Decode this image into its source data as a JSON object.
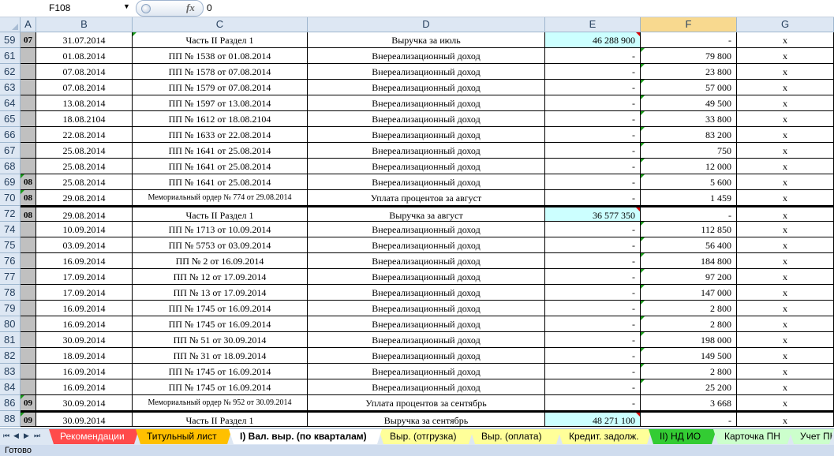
{
  "formula_bar": {
    "cell_ref": "F108",
    "fx_label": "fx",
    "value": "0"
  },
  "columns": [
    "A",
    "B",
    "C",
    "D",
    "E",
    "F",
    "G"
  ],
  "active_column": "F",
  "rows": [
    {
      "num": "59",
      "a": "07",
      "b": "31.07.2014",
      "c": "Часть II Раздел 1",
      "d": "Выручка за июль",
      "e": "46 288 900",
      "f": "-",
      "g": "x",
      "hl": true,
      "cg": true,
      "er": true
    },
    {
      "num": "61",
      "a": "",
      "b": "01.08.2014",
      "c": "ПП № 1538 от 01.08.2014",
      "d": "Внереализационный доход",
      "e": "-",
      "f": "79 800",
      "g": "x",
      "fg": true
    },
    {
      "num": "62",
      "a": "",
      "b": "07.08.2014",
      "c": "ПП № 1578 от 07.08.2014",
      "d": "Внереализационный доход",
      "e": "-",
      "f": "23 800",
      "g": "x",
      "fg": true
    },
    {
      "num": "63",
      "a": "",
      "b": "07.08.2014",
      "c": "ПП № 1579 от 07.08.2014",
      "d": "Внереализационный доход",
      "e": "-",
      "f": "57 000",
      "g": "x",
      "fg": true
    },
    {
      "num": "64",
      "a": "",
      "b": "13.08.2014",
      "c": "ПП № 1597 от 13.08.2014",
      "d": "Внереализационный доход",
      "e": "-",
      "f": "49 500",
      "g": "x",
      "fg": true
    },
    {
      "num": "65",
      "a": "",
      "b": "18.08.2104",
      "c": "ПП № 1612 от 18.08.2104",
      "d": "Внереализационный доход",
      "e": "-",
      "f": "33 800",
      "g": "x",
      "fg": true
    },
    {
      "num": "66",
      "a": "",
      "b": "22.08.2014",
      "c": "ПП № 1633 от 22.08.2014",
      "d": "Внереализационный доход",
      "e": "-",
      "f": "83 200",
      "g": "x",
      "fg": true
    },
    {
      "num": "67",
      "a": "",
      "b": "25.08.2014",
      "c": "ПП № 1641 от 25.08.2014",
      "d": "Внереализационный доход",
      "e": "-",
      "f": "750",
      "g": "x",
      "fg": true
    },
    {
      "num": "68",
      "a": "",
      "b": "25.08.2014",
      "c": "ПП № 1641 от 25.08.2014",
      "d": "Внереализационный доход",
      "e": "-",
      "f": "12 000",
      "g": "x",
      "fg": true
    },
    {
      "num": "69",
      "a": "08",
      "b": "25.08.2014",
      "c": "ПП № 1641 от 25.08.2014",
      "d": "Внереализационный доход",
      "e": "-",
      "f": "5 600",
      "g": "x",
      "fg": true,
      "ag": true
    },
    {
      "num": "70",
      "a": "08",
      "b": "29.08.2014",
      "c": "Мемориальный ордер № 774 от 29.08.2014",
      "d": "Уплата процентов за август",
      "e": "-",
      "f": "1 459",
      "g": "x",
      "small": true,
      "ag": true
    },
    {
      "num": "72",
      "a": "08",
      "b": "29.08.2014",
      "c": "Часть II Раздел 1",
      "d": "Выручка за август",
      "e": "36 577 350",
      "f": "-",
      "g": "x",
      "hl": true,
      "er": true,
      "thick": true
    },
    {
      "num": "74",
      "a": "",
      "b": "10.09.2014",
      "c": "ПП № 1713 от 10.09.2014",
      "d": "Внереализационный доход",
      "e": "-",
      "f": "112 850",
      "g": "x",
      "fg": true
    },
    {
      "num": "75",
      "a": "",
      "b": "03.09.2014",
      "c": "ПП № 5753 от 03.09.2014",
      "d": "Внереализационный доход",
      "e": "-",
      "f": "56 400",
      "g": "x",
      "fg": true
    },
    {
      "num": "76",
      "a": "",
      "b": "16.09.2014",
      "c": "ПП № 2 от 16.09.2014",
      "d": "Внереализационный доход",
      "e": "-",
      "f": "184 800",
      "g": "x",
      "fg": true
    },
    {
      "num": "77",
      "a": "",
      "b": "17.09.2014",
      "c": "ПП № 12 от 17.09.2014",
      "d": "Внереализационный доход",
      "e": "-",
      "f": "97 200",
      "g": "x",
      "fg": true
    },
    {
      "num": "78",
      "a": "",
      "b": "17.09.2014",
      "c": "ПП № 13 от 17.09.2014",
      "d": "Внереализационный доход",
      "e": "-",
      "f": "147 000",
      "g": "x",
      "fg": true
    },
    {
      "num": "79",
      "a": "",
      "b": "16.09.2014",
      "c": "ПП № 1745 от 16.09.2014",
      "d": "Внереализационный доход",
      "e": "-",
      "f": "2 800",
      "g": "x",
      "fg": true
    },
    {
      "num": "80",
      "a": "",
      "b": "16.09.2014",
      "c": "ПП № 1745 от 16.09.2014",
      "d": "Внереализационный доход",
      "e": "-",
      "f": "2 800",
      "g": "x",
      "fg": true
    },
    {
      "num": "81",
      "a": "",
      "b": "30.09.2014",
      "c": "ПП № 51 от 30.09.2014",
      "d": "Внереализационный доход",
      "e": "-",
      "f": "198 000",
      "g": "x",
      "fg": true
    },
    {
      "num": "82",
      "a": "",
      "b": "18.09.2014",
      "c": "ПП № 31 от 18.09.2014",
      "d": "Внереализационный доход",
      "e": "-",
      "f": "149 500",
      "g": "x",
      "fg": true
    },
    {
      "num": "83",
      "a": "",
      "b": "16.09.2014",
      "c": "ПП № 1745 от 16.09.2014",
      "d": "Внереализационный доход",
      "e": "-",
      "f": "2 800",
      "g": "x",
      "fg": true
    },
    {
      "num": "84",
      "a": "",
      "b": "16.09.2014",
      "c": "ПП № 1745 от 16.09.2014",
      "d": "Внереализационный доход",
      "e": "-",
      "f": "25 200",
      "g": "x",
      "fg": true
    },
    {
      "num": "86",
      "a": "09",
      "b": "30.09.2014",
      "c": "Мемориальный ордер № 952 от 30.09.2014",
      "d": "Уплата процентов за сентябрь",
      "e": "-",
      "f": "3 668",
      "g": "x",
      "small": true,
      "ag": true
    },
    {
      "num": "88",
      "a": "09",
      "b": "30.09.2014",
      "c": "Часть II Раздел 1",
      "d": "Выручка за сентябрь",
      "e": "48 271 100",
      "f": "-",
      "g": "x",
      "hl": true,
      "er": true,
      "thick": true,
      "ag": true
    }
  ],
  "sheet_tabs": [
    {
      "label": "Рекомендации",
      "color": "#ff4b4b",
      "text": "#ffffff"
    },
    {
      "label": "Титульный лист",
      "color": "#ffc000",
      "text": "#000000"
    },
    {
      "label": "I) Вал. выр. (по кварталам)",
      "color": "#ffffff",
      "text": "#000000",
      "active": true
    },
    {
      "label": "Выр. (отгрузка)",
      "color": "#ffff99",
      "text": "#000000"
    },
    {
      "label": "Выр. (оплата)",
      "color": "#ffff99",
      "text": "#000000"
    },
    {
      "label": "Кредит. задолж.",
      "color": "#ffff99",
      "text": "#000000"
    },
    {
      "label": "II) НД ИО",
      "color": "#33cc33",
      "text": "#000000"
    },
    {
      "label": "Карточка ПН",
      "color": "#ccffcc",
      "text": "#000000"
    },
    {
      "label": "Учет ПН",
      "color": "#ccffcc",
      "text": "#000000"
    }
  ],
  "status": {
    "text": "Готово"
  }
}
